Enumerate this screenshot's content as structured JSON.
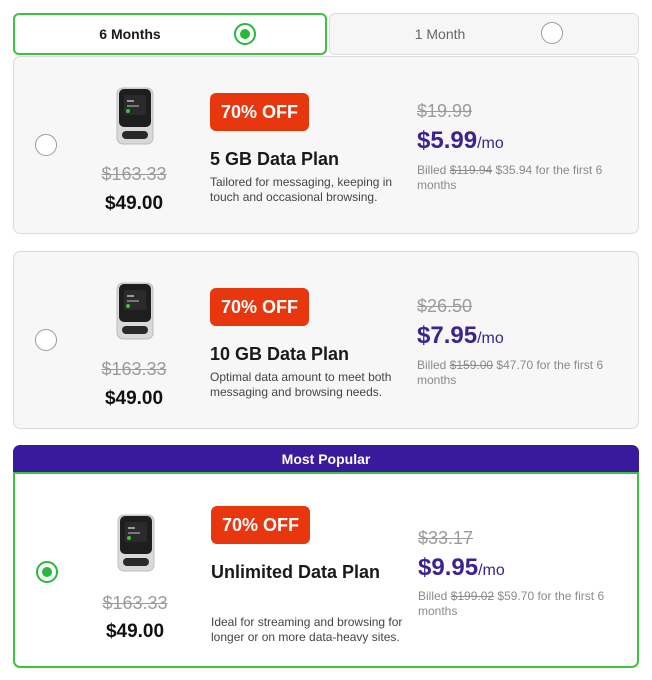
{
  "tabs": [
    {
      "label": "6 Months",
      "selected": true
    },
    {
      "label": "1 Month",
      "selected": false
    }
  ],
  "colors": {
    "accent_green": "#27b83c",
    "badge_red": "#e8370f",
    "price_purple": "#3b2392",
    "banner_purple": "#3a1a9c"
  },
  "popular_label": "Most Popular",
  "plans": [
    {
      "old_total": "$163.33",
      "new_total": "$49.00",
      "badge": "70% OFF",
      "name": "5 GB Data Plan",
      "description": "Tailored for messaging, keeping in touch and occasional browsing.",
      "old_price": "$19.99",
      "price": "$5.99",
      "per": "/mo",
      "billed_prefix": "Billed ",
      "billed_old": "$119.94",
      "billed_rest": " $35.94 for the first 6 months",
      "selected": false
    },
    {
      "old_total": "$163.33",
      "new_total": "$49.00",
      "badge": "70% OFF",
      "name": "10 GB Data Plan",
      "description": "Optimal data amount to meet both messaging and browsing needs.",
      "old_price": "$26.50",
      "price": "$7.95",
      "per": "/mo",
      "billed_prefix": "Billed ",
      "billed_old": "$159.00",
      "billed_rest": " $47.70 for the first 6 months",
      "selected": false
    },
    {
      "old_total": "$163.33",
      "new_total": "$49.00",
      "badge": "70% OFF",
      "name": "Unlimited Data Plan",
      "description": "Ideal for streaming and browsing for longer or on more data-heavy sites.",
      "old_price": "$33.17",
      "price": "$9.95",
      "per": "/mo",
      "billed_prefix": "Billed ",
      "billed_old": "$199.02",
      "billed_rest": " $59.70 for the first 6 months",
      "selected": true
    }
  ]
}
